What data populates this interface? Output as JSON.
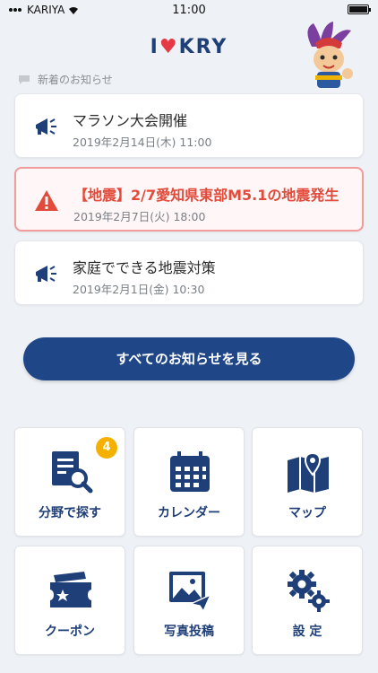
{
  "status_bar": {
    "carrier": "KARIYA",
    "time": "11:00"
  },
  "logo": {
    "text_left": "I",
    "text_right": "KRY"
  },
  "news_header": {
    "label": "新着のお知らせ"
  },
  "notices": [
    {
      "title": "マラソン大会開催",
      "date": "2019年2月14日(木) 11:00",
      "type": "announcement",
      "icon": "megaphone-icon"
    },
    {
      "title": "【地震】2/7愛知県東部M5.1の地震発生",
      "date": "2019年2月7日(火) 18:00",
      "type": "alert",
      "icon": "warning-icon"
    },
    {
      "title": "家庭でできる地震対策",
      "date": "2019年2月1日(金) 10:30",
      "type": "announcement",
      "icon": "megaphone-icon"
    }
  ],
  "see_all_button": {
    "label": "すべてのお知らせを見る"
  },
  "menu": [
    {
      "label": "分野で探す",
      "icon": "document-search-icon",
      "badge": "4"
    },
    {
      "label": "カレンダー",
      "icon": "calendar-icon"
    },
    {
      "label": "マップ",
      "icon": "map-icon"
    },
    {
      "label": "クーポン",
      "icon": "ticket-icon"
    },
    {
      "label": "写真投稿",
      "icon": "photo-send-icon"
    },
    {
      "label": "設 定",
      "icon": "gear-icon"
    }
  ],
  "colors": {
    "brand": "#1f4787",
    "alert": "#e24b3b",
    "badge": "#f5b100",
    "background": "#eef1f5"
  }
}
